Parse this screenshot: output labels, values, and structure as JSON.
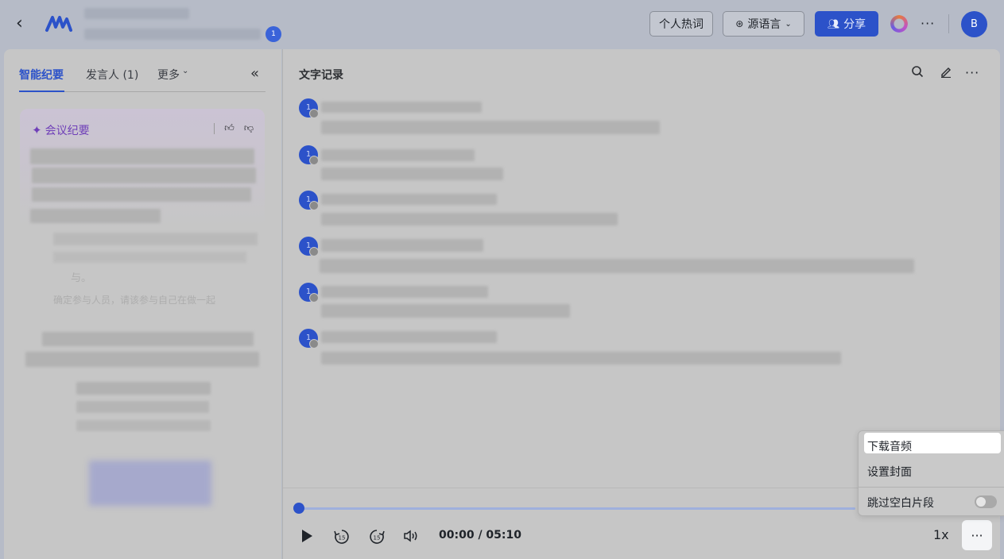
{
  "header": {
    "notification_count": "1",
    "buttons": {
      "personal_hotwords": "个人热词",
      "source_language": "源语言",
      "share": "分享"
    },
    "avatar_initial": "B",
    "more_glyph": "···"
  },
  "left_panel": {
    "tabs": [
      {
        "label": "智能纪要",
        "active": true
      },
      {
        "label": "发言人 (1)",
        "active": false
      },
      {
        "label": "更多",
        "active": false
      }
    ],
    "collapse_glyph": "«",
    "summary_card": {
      "title": "会议纪要"
    },
    "faint_text": [
      "与。",
      "确定参与人员，请该参与自己在做一起"
    ]
  },
  "right_panel": {
    "title": "文字记录",
    "speaker_initial": "1",
    "player": {
      "time": "00:00 / 05:10",
      "speed": "1x",
      "rewind_label": "15",
      "forward_label": "15"
    }
  },
  "menu": {
    "items": [
      {
        "label": "下载音频"
      },
      {
        "label": "设置封面"
      },
      {
        "label": "跳过空白片段"
      }
    ],
    "skip_blank_enabled": false
  },
  "colors": {
    "accent": "#2c52c9",
    "ai_purple": "#6f3fb8"
  }
}
